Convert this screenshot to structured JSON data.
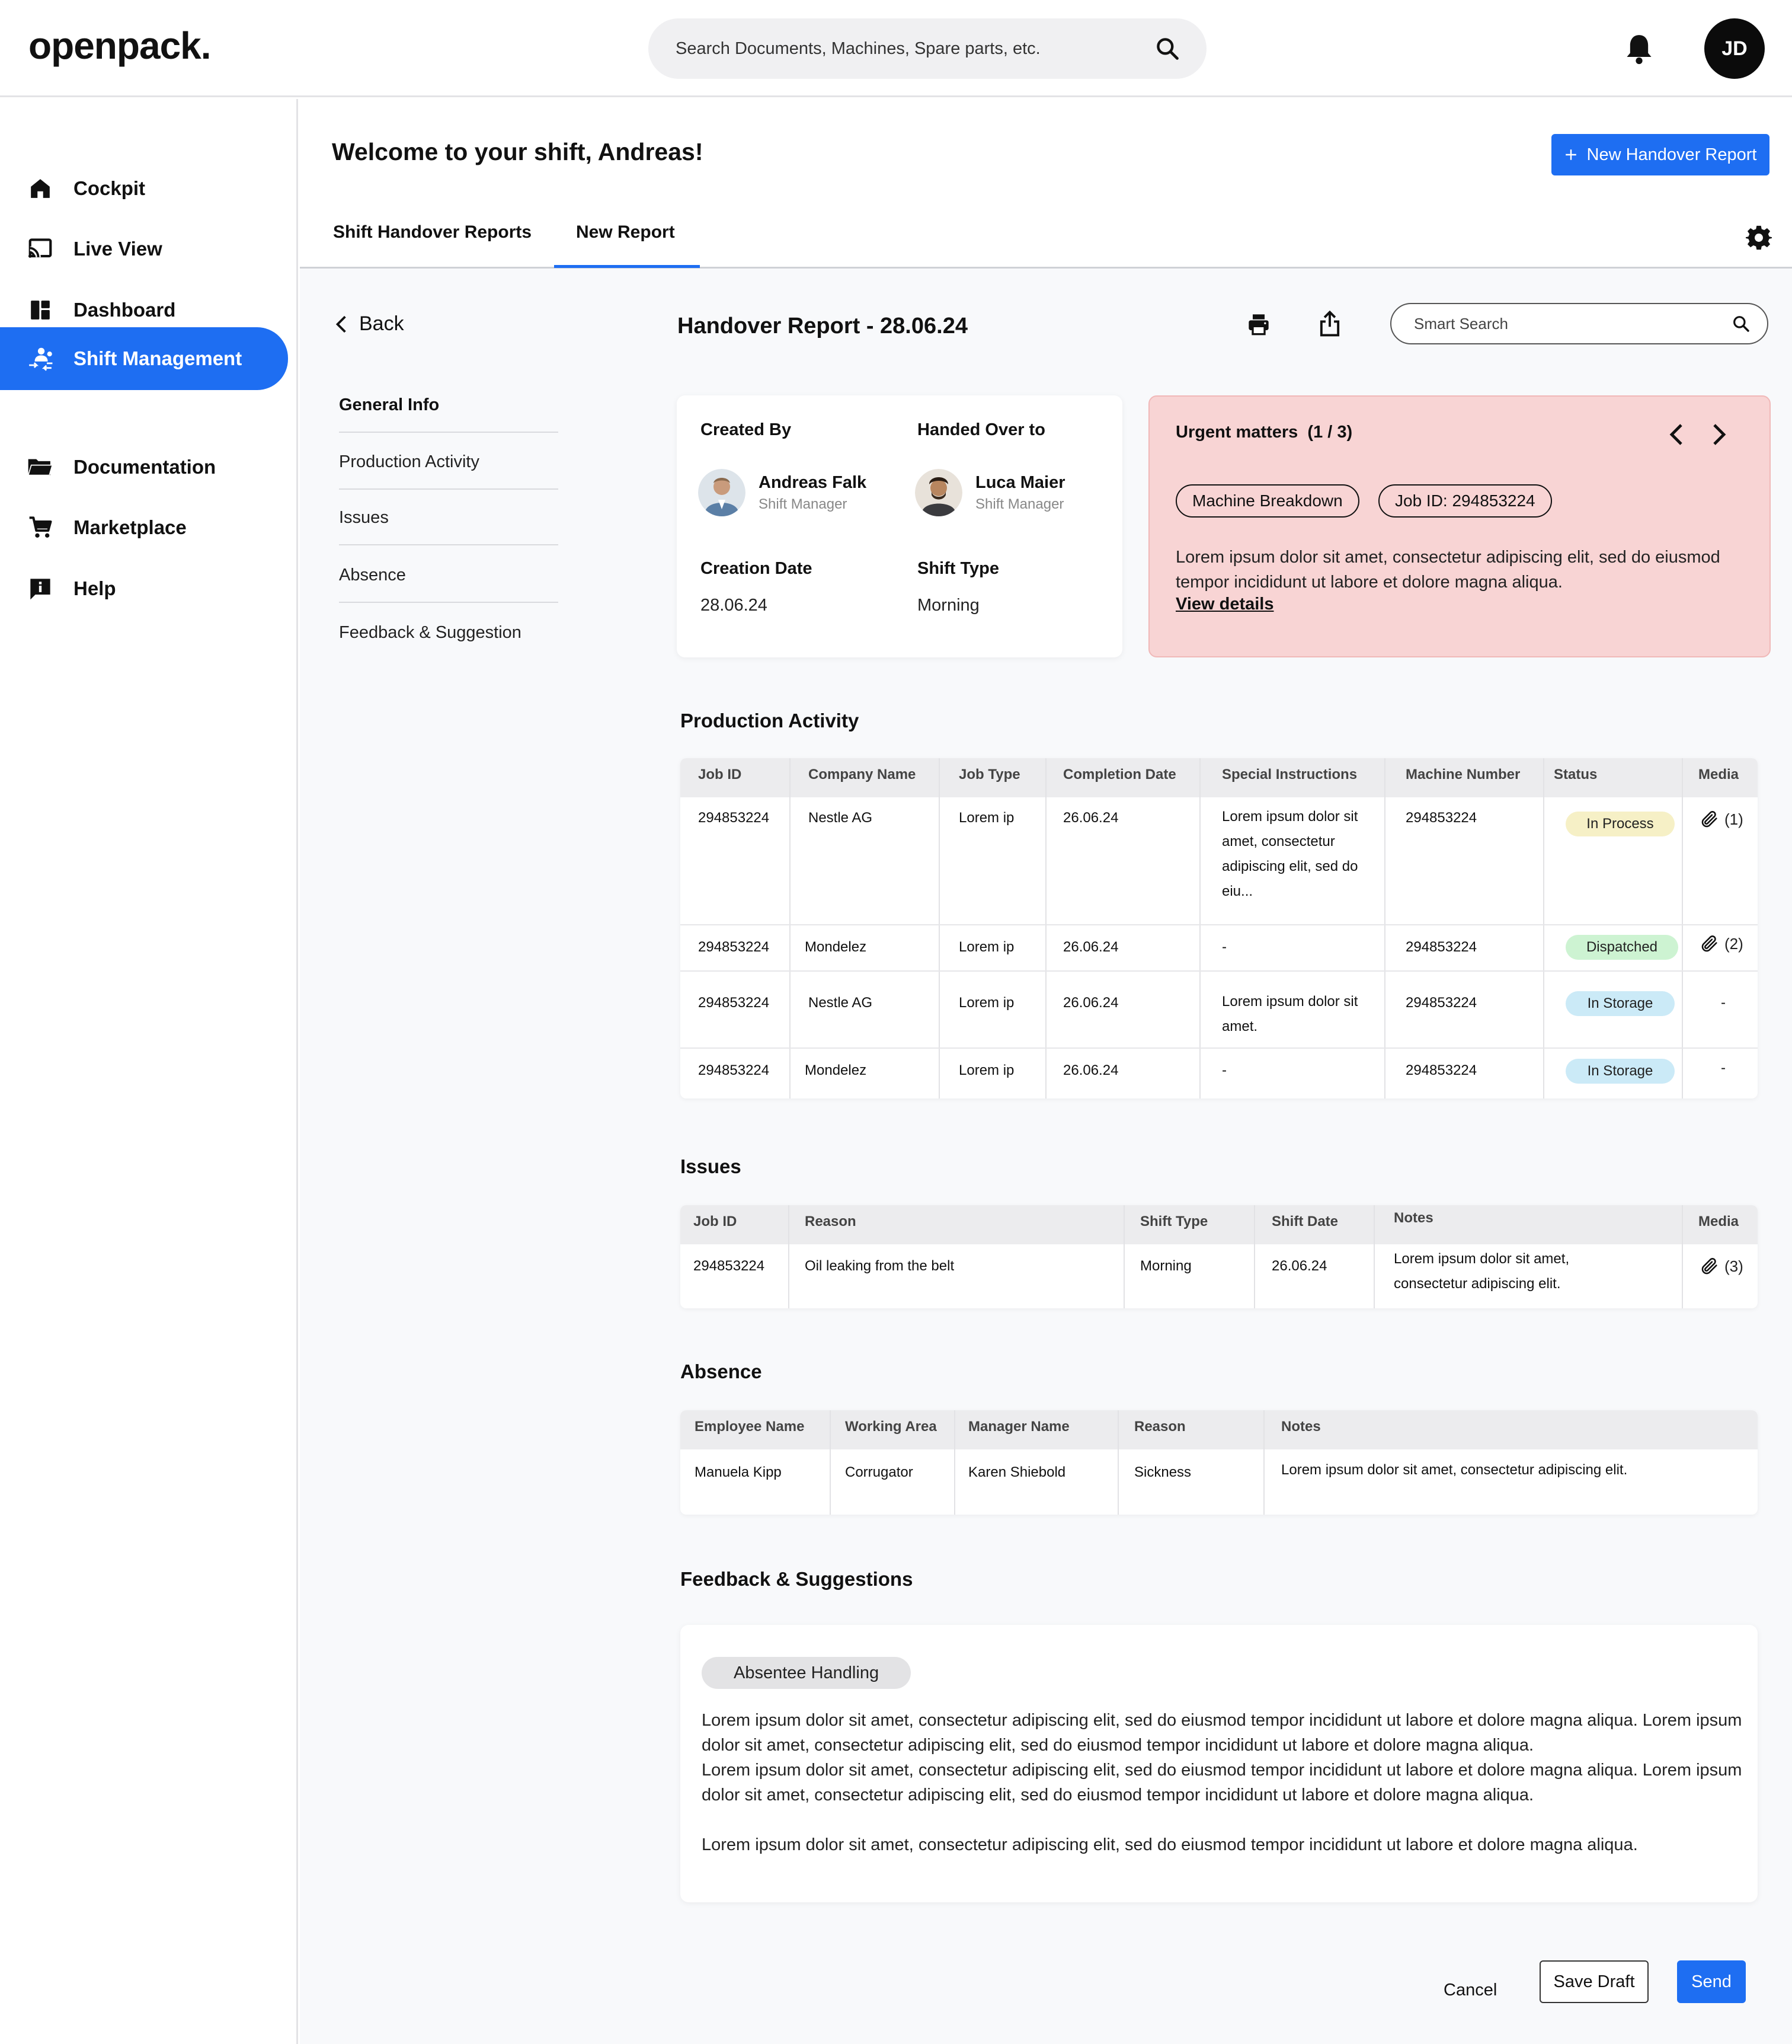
{
  "header": {
    "logo": "openpack.",
    "search_placeholder": "Search Documents, Machines, Spare parts, etc.",
    "avatar_initials": "JD"
  },
  "sidebar": {
    "items": [
      {
        "label": "Cockpit",
        "icon": "home-icon"
      },
      {
        "label": "Live View",
        "icon": "cast-icon"
      },
      {
        "label": "Dashboard",
        "icon": "dashboard-icon"
      },
      {
        "label": "Shift Management",
        "icon": "people-swap-icon",
        "active": true
      },
      {
        "label": "Documentation",
        "icon": "folder-icon"
      },
      {
        "label": "Marketplace",
        "icon": "cart-icon"
      },
      {
        "label": "Help",
        "icon": "help-icon"
      }
    ]
  },
  "main": {
    "welcome": "Welcome to your shift, Andreas!",
    "new_report_button": "New Handover Report",
    "tabs": [
      "Shift Handover Reports",
      "New Report"
    ],
    "active_tab": "New Report"
  },
  "section_nav": {
    "back": "Back",
    "items": [
      "General Info",
      "Production Activity",
      "Issues",
      "Absence",
      "Feedback & Suggestion"
    ]
  },
  "report": {
    "title": "Handover Report - 28.06.24",
    "smart_search_placeholder": "Smart Search"
  },
  "info": {
    "created_by_label": "Created By",
    "handed_over_label": "Handed Over to",
    "creator": {
      "name": "Andreas Falk",
      "role": "Shift Manager"
    },
    "receiver": {
      "name": "Luca Maier",
      "role": "Shift Manager"
    },
    "creation_date_label": "Creation Date",
    "creation_date": "28.06.24",
    "shift_type_label": "Shift Type",
    "shift_type": "Morning"
  },
  "urgent": {
    "title": "Urgent matters",
    "counter": "(1 / 3)",
    "tags": [
      "Machine Breakdown",
      "Job ID: 294853224"
    ],
    "text": "Lorem ipsum dolor sit amet, consectetur adipiscing elit, sed do eiusmod tempor incididunt ut labore et dolore magna aliqua.",
    "link": "View details",
    "bg_color": "#f8d4d4"
  },
  "production": {
    "title": "Production Activity",
    "headers": [
      "Job ID",
      "Company Name",
      "Job Type",
      "Completion Date",
      "Special Instructions",
      "Machine Number",
      "Status",
      "Media"
    ],
    "rows": [
      {
        "job_id": "294853224",
        "company": "Nestle AG",
        "type": "Lorem ip",
        "date": "26.06.24",
        "instructions": "Lorem ipsum dolor sit amet, consectetur adipiscing elit, sed do eiu...",
        "machine": "294853224",
        "status": "In Process",
        "media": "(1)"
      },
      {
        "job_id": "294853224",
        "company": "Mondelez",
        "type": "Lorem ip",
        "date": "26.06.24",
        "instructions": "-",
        "machine": "294853224",
        "status": "Dispatched",
        "media": "(2)"
      },
      {
        "job_id": "294853224",
        "company": "Nestle AG",
        "type": "Lorem ip",
        "date": "26.06.24",
        "instructions": "Lorem ipsum dolor sit amet.",
        "machine": "294853224",
        "status": "In Storage",
        "media": "-"
      },
      {
        "job_id": "294853224",
        "company": "Mondelez",
        "type": "Lorem ip",
        "date": "26.06.24",
        "instructions": "-",
        "machine": "294853224",
        "status": "In Storage",
        "media": "-"
      }
    ],
    "status_colors": {
      "In Process": "#f6f0c6",
      "Dispatched": "#cdf3d2",
      "In Storage": "#cbeaf7"
    }
  },
  "issues": {
    "title": "Issues",
    "headers": [
      "Job ID",
      "Reason",
      "Shift Type",
      "Shift Date",
      "Notes",
      "Media"
    ],
    "rows": [
      {
        "job_id": "294853224",
        "reason": "Oil leaking from the belt",
        "shift_type": "Morning",
        "shift_date": "26.06.24",
        "notes": "Lorem ipsum dolor sit amet, consectetur adipiscing elit.",
        "media": "(3)"
      }
    ]
  },
  "absence": {
    "title": "Absence",
    "headers": [
      "Employee Name",
      "Working Area",
      "Manager Name",
      "Reason",
      "Notes"
    ],
    "rows": [
      {
        "employee": "Manuela Kipp",
        "area": "Corrugator",
        "manager": "Karen Shiebold",
        "reason": "Sickness",
        "notes": "Lorem ipsum dolor sit amet, consectetur adipiscing elit."
      }
    ]
  },
  "feedback": {
    "title": "Feedback & Suggestions",
    "tag": "Absentee Handling",
    "paragraphs": [
      "Lorem ipsum dolor sit amet, consectetur adipiscing elit, sed do eiusmod tempor incididunt ut labore et dolore magna aliqua. Lorem ipsum dolor sit amet, consectetur adipiscing elit, sed do eiusmod tempor incididunt ut labore et dolore magna aliqua.",
      "Lorem ipsum dolor sit amet, consectetur adipiscing elit, sed do eiusmod tempor incididunt ut labore et dolore magna aliqua. Lorem ipsum dolor sit amet, consectetur adipiscing elit, sed do eiusmod tempor incididunt ut labore et dolore magna aliqua.",
      "Lorem ipsum dolor sit amet, consectetur adipiscing elit, sed do eiusmod tempor incididunt ut labore et dolore magna aliqua."
    ]
  },
  "footer": {
    "cancel": "Cancel",
    "save_draft": "Save Draft",
    "send": "Send"
  },
  "colors": {
    "accent": "#1e6ef2"
  }
}
